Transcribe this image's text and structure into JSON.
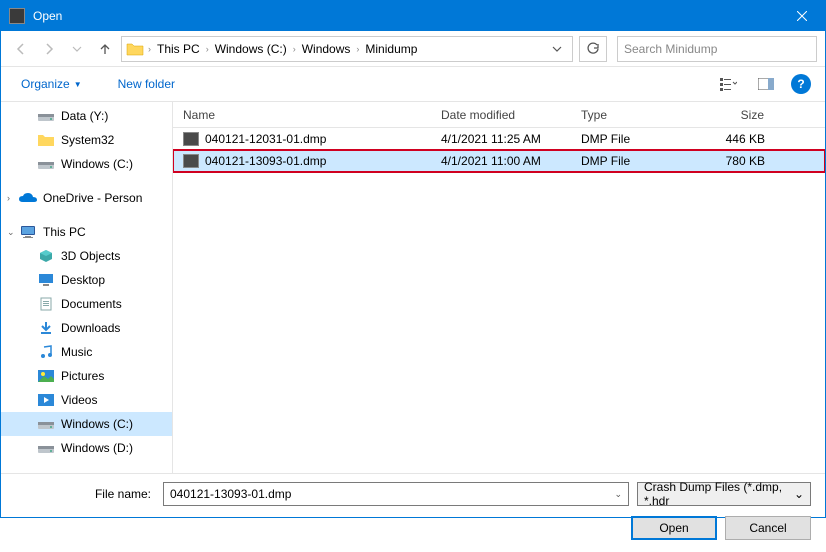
{
  "title": "Open",
  "breadcrumb": [
    "This PC",
    "Windows (C:)",
    "Windows",
    "Minidump"
  ],
  "search_placeholder": "Search Minidump",
  "toolbar": {
    "organize": "Organize",
    "new_folder": "New folder"
  },
  "sidebar": {
    "items": [
      {
        "label": "Data (Y:)",
        "icon": "drive",
        "indent": 1
      },
      {
        "label": "System32",
        "icon": "folder",
        "indent": 1
      },
      {
        "label": "Windows (C:)",
        "icon": "drive",
        "indent": 1
      },
      {
        "label": "",
        "icon": "spacer"
      },
      {
        "label": "OneDrive - Person",
        "icon": "onedrive",
        "indent": 0,
        "expander": ">"
      },
      {
        "label": "",
        "icon": "spacer"
      },
      {
        "label": "This PC",
        "icon": "thispc",
        "indent": 0,
        "expander": "v"
      },
      {
        "label": "3D Objects",
        "icon": "3d",
        "indent": 1
      },
      {
        "label": "Desktop",
        "icon": "desktop",
        "indent": 1
      },
      {
        "label": "Documents",
        "icon": "docs",
        "indent": 1
      },
      {
        "label": "Downloads",
        "icon": "downloads",
        "indent": 1
      },
      {
        "label": "Music",
        "icon": "music",
        "indent": 1
      },
      {
        "label": "Pictures",
        "icon": "pictures",
        "indent": 1
      },
      {
        "label": "Videos",
        "icon": "videos",
        "indent": 1
      },
      {
        "label": "Windows (C:)",
        "icon": "drive",
        "indent": 1,
        "selected": true
      },
      {
        "label": "Windows (D:)",
        "icon": "drive",
        "indent": 1
      }
    ]
  },
  "columns": {
    "name": "Name",
    "date": "Date modified",
    "type": "Type",
    "size": "Size"
  },
  "files": [
    {
      "name": "040121-12031-01.dmp",
      "date": "4/1/2021 11:25 AM",
      "type": "DMP File",
      "size": "446 KB",
      "selected": false
    },
    {
      "name": "040121-13093-01.dmp",
      "date": "4/1/2021 11:00 AM",
      "type": "DMP File",
      "size": "780 KB",
      "selected": true
    }
  ],
  "footer": {
    "filename_label": "File name:",
    "filename_value": "040121-13093-01.dmp",
    "filter": "Crash Dump Files (*.dmp, *.hdr",
    "open": "Open",
    "cancel": "Cancel"
  }
}
